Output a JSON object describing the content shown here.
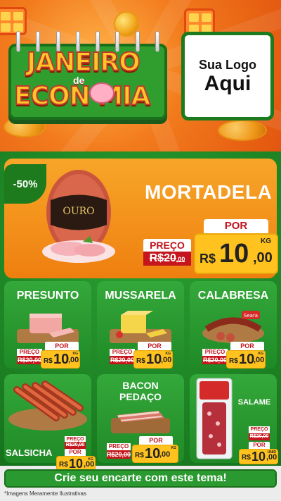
{
  "header": {
    "title_line1": "JANEIRO",
    "title_connector": "de",
    "title_line2": "ECON MIA",
    "logo_line1": "Sua Logo",
    "logo_line2": "Aqui"
  },
  "hero": {
    "discount": "-50%",
    "name": "MORTADELA",
    "por_label": "POR",
    "preco_label": "PREÇO",
    "old_price_int": "R$20",
    "old_price_dec": ",00",
    "currency": "R$",
    "price_int": "10",
    "price_dec": ",00",
    "unit": "KG"
  },
  "products": [
    {
      "name": "PRESUNTO",
      "preco_label": "PREÇO",
      "old": "R$20,00",
      "por_label": "POR",
      "currency": "R$",
      "price_int": "10",
      "price_dec": ",00",
      "unit": "KG"
    },
    {
      "name": "MUSSARELA",
      "preco_label": "PREÇO",
      "old": "R$20,00",
      "por_label": "POR",
      "currency": "R$",
      "price_int": "10",
      "price_dec": ",00",
      "unit": "KG"
    },
    {
      "name": "CALABRESA",
      "preco_label": "PREÇO",
      "old": "R$20,00",
      "por_label": "POR",
      "currency": "R$",
      "price_int": "10",
      "price_dec": ",00",
      "unit": "KG"
    },
    {
      "name": "SALSICHA",
      "preco_label": "PREÇO",
      "old": "R$20,00",
      "por_label": "POR",
      "currency": "R$",
      "price_int": "10",
      "price_dec": ",00",
      "unit": "KG"
    },
    {
      "name": "BACON PEDAÇO",
      "preco_label": "PREÇO",
      "old": "R$20,00",
      "por_label": "POR",
      "currency": "R$",
      "price_int": "10",
      "price_dec": ",00",
      "unit": "KG"
    },
    {
      "name": "SALAME",
      "preco_label": "PREÇO",
      "old": "R$20,00",
      "por_label": "POR",
      "currency": "R$",
      "price_int": "10",
      "price_dec": ",00",
      "unit": "UNID"
    }
  ],
  "cta": "Crie seu encarte com este tema!",
  "footer_note": "*Imagens Meramente Ilustrativas",
  "colors": {
    "green": "#1e8a28",
    "orange": "#f5961a",
    "yellow": "#ffc21e",
    "red": "#c4161c"
  }
}
